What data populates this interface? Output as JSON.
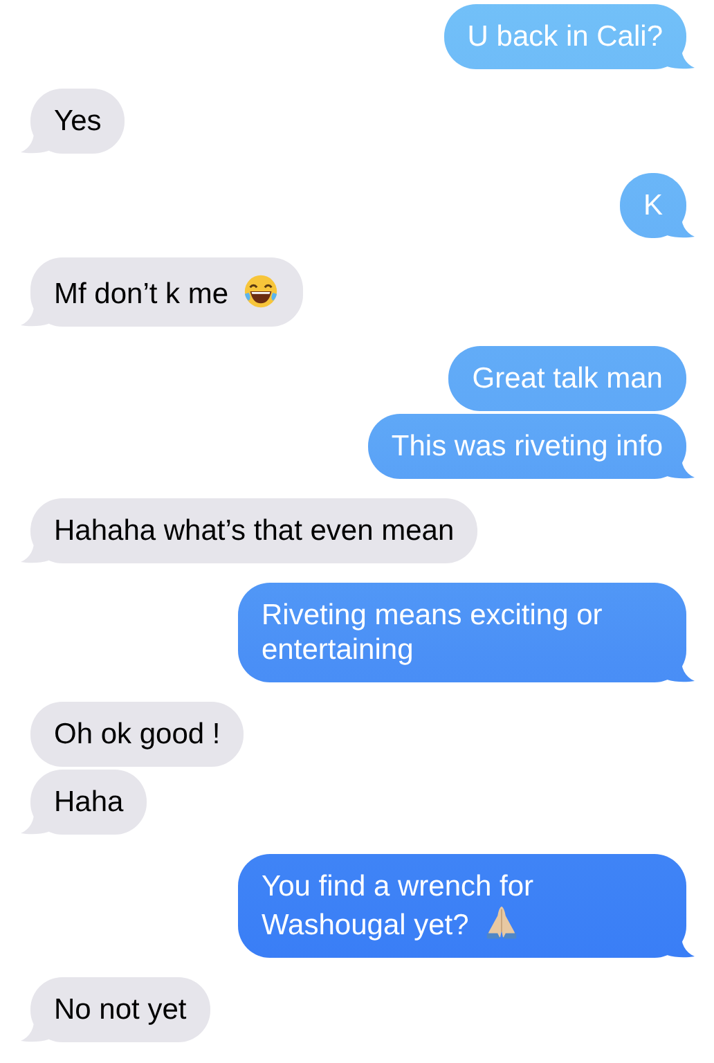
{
  "messages": [
    {
      "kind": "sent",
      "text": "U back in Cali?",
      "tail": true
    },
    {
      "kind": "received",
      "text": "Yes",
      "tail": true
    },
    {
      "kind": "sent",
      "text": "K",
      "tail": true
    },
    {
      "kind": "received",
      "text": "Mf don’t k me",
      "inline": [
        {
          "kind": "laughing"
        }
      ],
      "tail": true
    },
    {
      "kind": "sent",
      "text": "Great talk man",
      "tail": false
    },
    {
      "kind": "sent",
      "text": "This was riveting info",
      "tail": true
    },
    {
      "kind": "received",
      "text": "Hahaha what’s that even mean",
      "tail": true
    },
    {
      "kind": "sent",
      "text": "Riveting means exciting or entertaining",
      "tail": true
    },
    {
      "kind": "received",
      "text": "Oh ok good !",
      "tail": false
    },
    {
      "kind": "received",
      "text": "Haha",
      "tail": true
    },
    {
      "kind": "sent",
      "text": "You find a wrench for Washougal yet?",
      "inline": [
        {
          "kind": "praying"
        }
      ],
      "tail": true
    },
    {
      "kind": "received",
      "text": "No not yet",
      "tail": true
    }
  ]
}
